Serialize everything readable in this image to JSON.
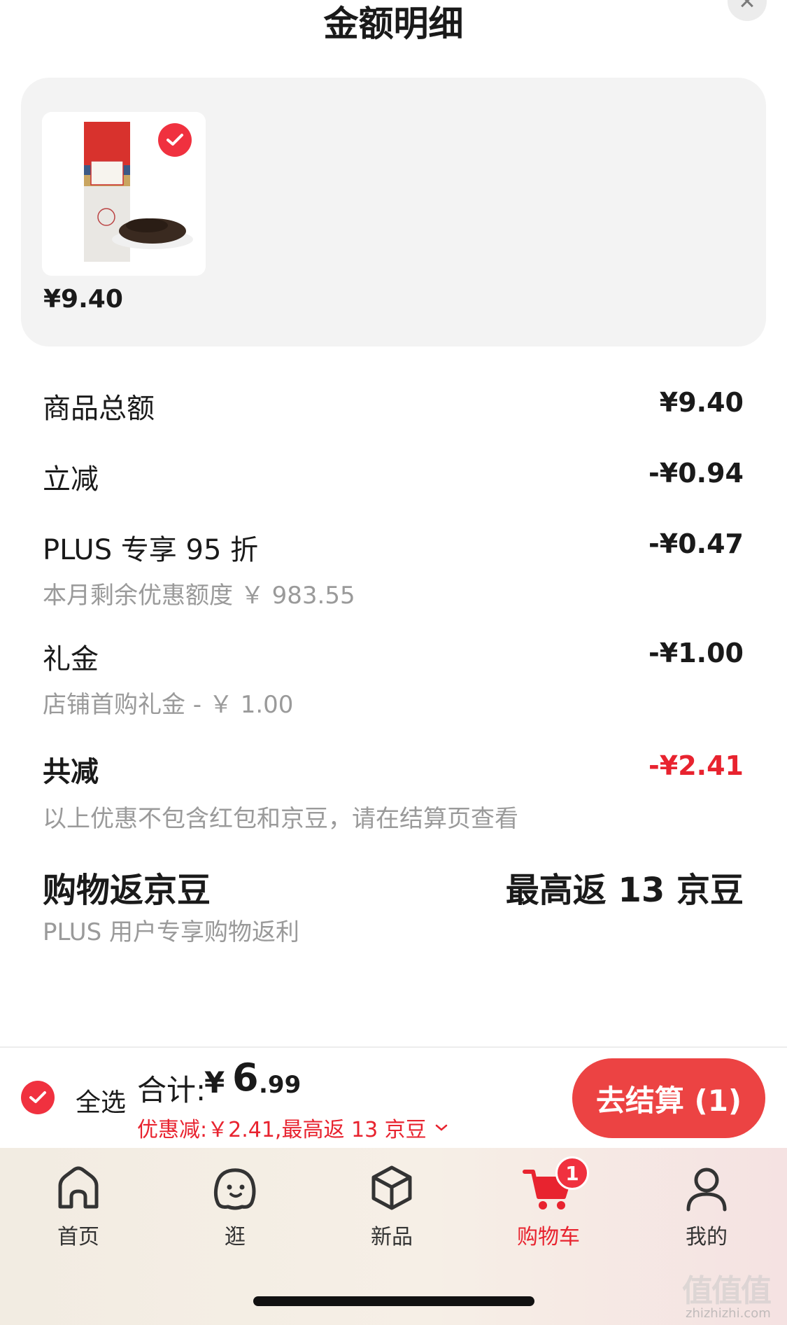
{
  "header": {
    "title": "金额明细"
  },
  "goods": {
    "price": "¥9.40"
  },
  "details": {
    "goods_total_label": "商品总额",
    "goods_total_value": "¥9.40",
    "instant_cut_label": "立减",
    "instant_cut_value": "-¥0.94",
    "plus_label": "PLUS 专享 95 折",
    "plus_value": "-¥0.47",
    "plus_sub": "本月剩余优惠额度 ￥ 983.55",
    "gift_label": "礼金",
    "gift_value": "-¥1.00",
    "gift_sub": "店铺首购礼金 - ￥ 1.00",
    "total_cut_label": "共减",
    "total_cut_value": "-¥2.41",
    "total_cut_sub": "以上优惠不包含红包和京豆，请在结算页查看",
    "beans_label": "购物返京豆",
    "beans_value": "最高返 13 京豆",
    "beans_sub": "PLUS 用户专享购物返利"
  },
  "footer": {
    "select_all": "全选",
    "total_label": "合计:",
    "total_yen": "¥",
    "total_int": "6",
    "total_dec": ".99",
    "saving": "优惠减:￥2.41,最高返 13 京豆",
    "checkout": "去结算 (1)"
  },
  "tabs": [
    {
      "label": "首页",
      "icon": "home-icon"
    },
    {
      "label": "逛",
      "icon": "stroll-face-icon"
    },
    {
      "label": "新品",
      "icon": "cube-icon"
    },
    {
      "label": "购物车",
      "icon": "cart-icon",
      "badge": "1"
    },
    {
      "label": "我的",
      "icon": "person-icon"
    }
  ],
  "watermark": {
    "main": "值值值",
    "sub": "zhizhizhi.com"
  },
  "colors": {
    "accent": "#e8232f",
    "button": "#ec4343",
    "card": "#f3f3f3",
    "muted": "#9a9a9a"
  }
}
